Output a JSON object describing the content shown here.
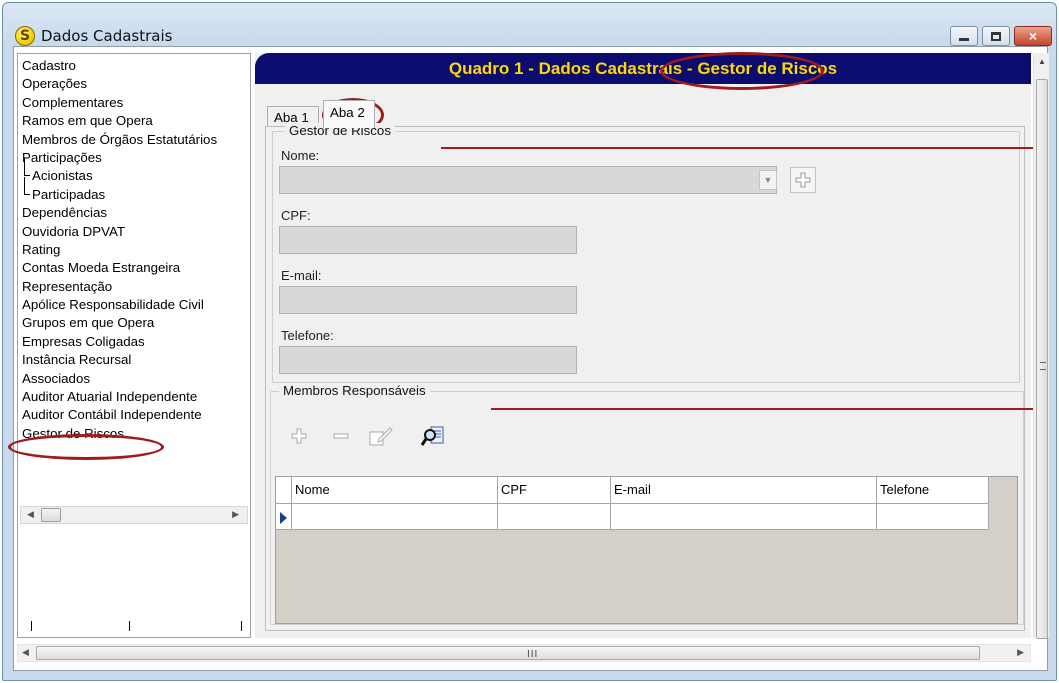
{
  "window": {
    "title": "Dados Cadastrais",
    "app_icon_letter": "S",
    "controls": {
      "minimize": "minimize",
      "maximize": "maximize",
      "close": "×"
    }
  },
  "tree": {
    "items": [
      {
        "label": "Cadastro",
        "level": 0
      },
      {
        "label": "Operações",
        "level": 0
      },
      {
        "label": "Complementares",
        "level": 0
      },
      {
        "label": "Ramos em que Opera",
        "level": 0
      },
      {
        "label": "Membros de Órgãos Estatutários",
        "level": 0
      },
      {
        "label": "Participações",
        "level": 0
      },
      {
        "label": "Acionistas",
        "level": 1
      },
      {
        "label": "Participadas",
        "level": 1
      },
      {
        "label": "Dependências",
        "level": 0
      },
      {
        "label": "Ouvidoria DPVAT",
        "level": 0
      },
      {
        "label": "Rating",
        "level": 0
      },
      {
        "label": "Contas Moeda Estrangeira",
        "level": 0
      },
      {
        "label": "Representação",
        "level": 0
      },
      {
        "label": "Apólice Responsabilidade Civil",
        "level": 0
      },
      {
        "label": "Grupos em que Opera",
        "level": 0
      },
      {
        "label": "Empresas Coligadas",
        "level": 0
      },
      {
        "label": "Instância Recursal",
        "level": 0
      },
      {
        "label": "Associados",
        "level": 0
      },
      {
        "label": "Auditor Atuarial Independente",
        "level": 0
      },
      {
        "label": "Auditor Contábil Independente",
        "level": 0
      },
      {
        "label": "Gestor de Riscos",
        "level": 0,
        "selected": true
      }
    ]
  },
  "header": {
    "prefix": "Quadro 1 - Dados Cadastrais - ",
    "highlight": "Gestor de Riscos"
  },
  "tabs": [
    {
      "label": "Aba 1",
      "active": false
    },
    {
      "label": "Aba 2",
      "active": true
    }
  ],
  "gestor": {
    "legend": "Gestor de Riscos",
    "nome_label": "Nome:",
    "nome_value": "",
    "cpf_label": "CPF:",
    "cpf_value": "",
    "email_label": "E-mail:",
    "email_value": "",
    "telefone_label": "Telefone:",
    "telefone_value": ""
  },
  "membros": {
    "legend": "Membros Responsáveis",
    "columns": [
      "Nome",
      "CPF",
      "E-mail",
      "Telefone"
    ],
    "rows": [
      [
        "",
        "",
        "",
        ""
      ]
    ],
    "toolbar": [
      "add-icon",
      "remove-icon",
      "edit-icon",
      "search-icon"
    ]
  },
  "scroll": {
    "grip": "III"
  },
  "colors": {
    "header_bg": "#0c0c6e",
    "header_text": "#ffd800",
    "annotation": "#a01b1b"
  }
}
